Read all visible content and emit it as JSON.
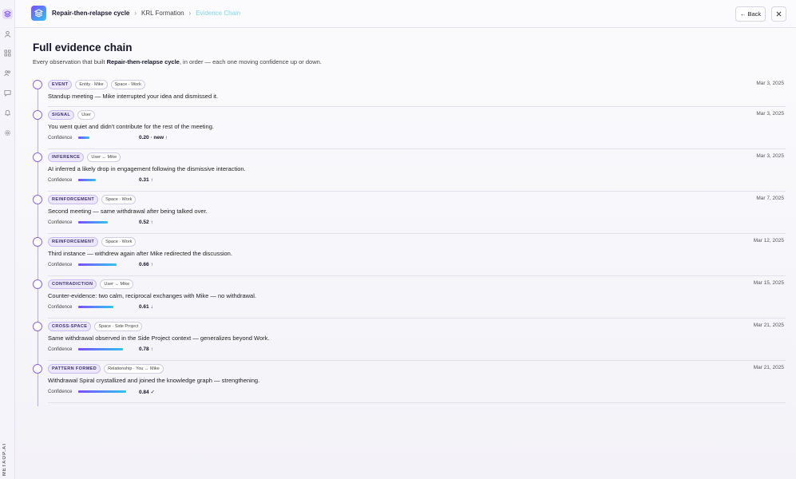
{
  "sidebar": {
    "brand": "METAOP.AI",
    "icons": [
      "layers-icon",
      "user-icon",
      "grid-icon",
      "people-icon",
      "chat-icon",
      "bell-icon",
      "settings-icon"
    ]
  },
  "header": {
    "breadcrumbs": [
      "Repair-then-relapse cycle",
      "KRL Formation",
      "Evidence Chain"
    ],
    "back_label": "← Back",
    "close_icon": "close-icon"
  },
  "page": {
    "title": "Full evidence chain",
    "subtitle_pre": "Every observation that built ",
    "subtitle_bold": "Repair-then-relapse cycle",
    "subtitle_post": ", in order — each one moving confidence up or down."
  },
  "colors": {
    "accent": "#7c4dff",
    "accent2": "#2ec5f0",
    "breadcrumb_active": "#7fd6ec"
  },
  "confidence_label": "Confidence",
  "evidence": [
    {
      "type": "EVENT",
      "contexts": [
        "Entity · Mike",
        "Space · Work"
      ],
      "date": "Mar 3, 2025",
      "text": "Standup meeting — Mike interrupted your idea and dismissed it.",
      "confidence": null,
      "confidence_text": ""
    },
    {
      "type": "SIGNAL",
      "contexts": [
        "User"
      ],
      "date": "Mar 3, 2025",
      "text": "You went quiet and didn't contribute for the rest of the meeting.",
      "confidence": 0.2,
      "confidence_text": "0.20 · new ↑"
    },
    {
      "type": "INFERENCE",
      "contexts": [
        "User ↔ Mike"
      ],
      "date": "Mar 3, 2025",
      "text": "AI inferred a likely drop in engagement following the dismissive interaction.",
      "confidence": 0.31,
      "confidence_text": "0.31 ↑"
    },
    {
      "type": "REINFORCEMENT",
      "contexts": [
        "Space · Work"
      ],
      "date": "Mar 7, 2025",
      "text": "Second meeting — same withdrawal after being talked over.",
      "confidence": 0.52,
      "confidence_text": "0.52 ↑"
    },
    {
      "type": "REINFORCEMENT",
      "contexts": [
        "Space · Work"
      ],
      "date": "Mar 12, 2025",
      "text": "Third instance — withdrew again after Mike redirected the discussion.",
      "confidence": 0.66,
      "confidence_text": "0.66 ↑"
    },
    {
      "type": "CONTRADICTION",
      "contexts": [
        "User ↔ Mike"
      ],
      "date": "Mar 15, 2025",
      "text": "Counter-evidence: two calm, reciprocal exchanges with Mike — no withdrawal.",
      "confidence": 0.61,
      "confidence_text": "0.61 ↓"
    },
    {
      "type": "CROSS-SPACE",
      "contexts": [
        "Space · Side Project"
      ],
      "date": "Mar 21, 2025",
      "text": "Same withdrawal observed in the Side Project context — generalizes beyond Work.",
      "confidence": 0.78,
      "confidence_text": "0.78 ↑"
    },
    {
      "type": "PATTERN FORMED",
      "contexts": [
        "Relationship · You ↔ Mike"
      ],
      "date": "Mar 21, 2025",
      "text": "Withdrawal Spiral crystallized and joined the knowledge graph — strengthening.",
      "confidence": 0.84,
      "confidence_text": "0.84 ✓"
    }
  ]
}
